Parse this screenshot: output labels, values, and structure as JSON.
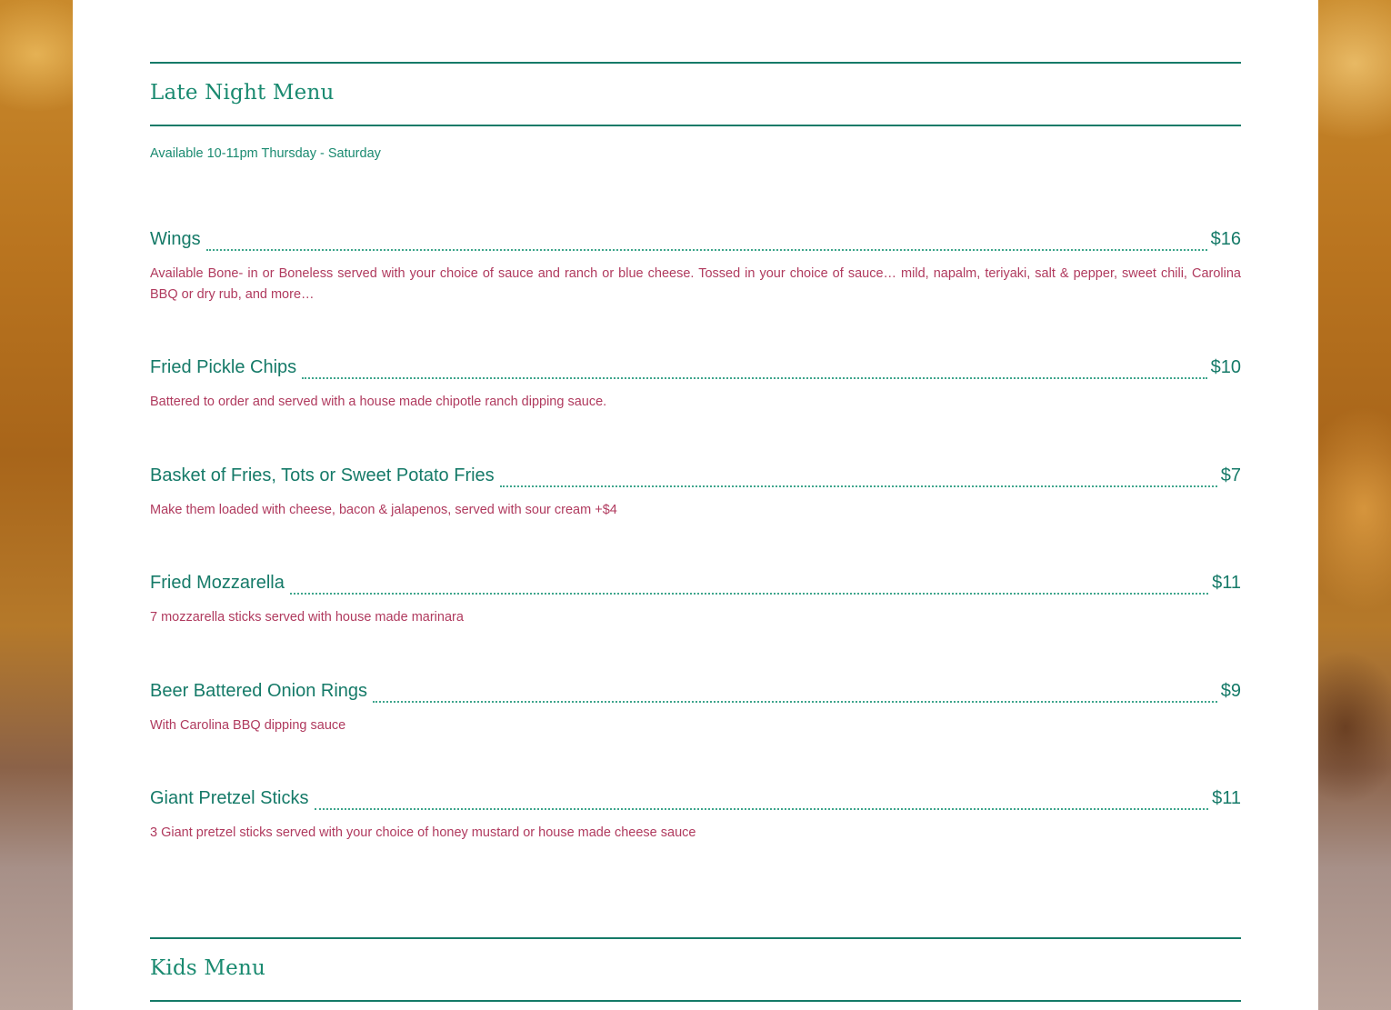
{
  "colors": {
    "accent": "#157a68",
    "heading": "#1a8a70",
    "description": "#b03a5e",
    "panel": "#ffffff"
  },
  "late_night": {
    "title": "Late Night Menu",
    "availability": "Available 10-11pm Thursday - Saturday",
    "items": [
      {
        "name": "Wings",
        "price": "$16",
        "description": "Available Bone- in or Boneless served with your choice of sauce and ranch or blue cheese. Tossed in your choice of sauce… mild, napalm, teriyaki, salt & pepper, sweet chili, Carolina BBQ or dry rub, and more…"
      },
      {
        "name": "Fried Pickle Chips",
        "price": "$10",
        "description": "Battered to order and served with a house made chipotle ranch dipping sauce."
      },
      {
        "name": "Basket of Fries, Tots or Sweet Potato Fries",
        "price": "$7",
        "description": "Make them loaded with cheese, bacon & jalapenos, served with sour cream +$4"
      },
      {
        "name": "Fried Mozzarella",
        "price": "$11",
        "description": "7 mozzarella sticks served with house made marinara"
      },
      {
        "name": "Beer Battered Onion Rings",
        "price": "$9",
        "description": "With Carolina BBQ dipping sauce"
      },
      {
        "name": "Giant Pretzel Sticks",
        "price": "$11",
        "description": "3 Giant pretzel sticks served with your choice of honey mustard or house made cheese sauce"
      }
    ]
  },
  "kids": {
    "title": "Kids Menu"
  }
}
